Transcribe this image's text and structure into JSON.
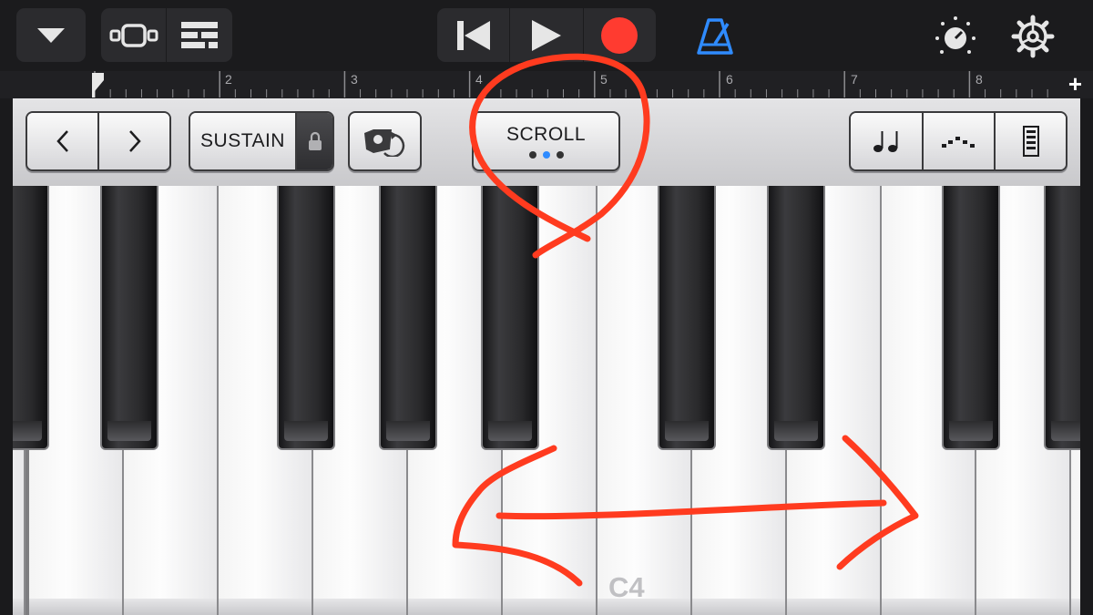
{
  "toolbar": {
    "left_icons": [
      "chevron-down-icon",
      "tracks-view-icon",
      "mixer-icon"
    ],
    "transport_icons": [
      "skip-back-icon",
      "play-icon",
      "record-icon"
    ],
    "right_icons": [
      "metronome-icon",
      "master-knob-icon",
      "gear-icon"
    ],
    "colors": {
      "record": "#ff3b30",
      "metronome": "#2f8bff"
    }
  },
  "ruler": {
    "bars": [
      "2",
      "3",
      "4",
      "5",
      "6",
      "7",
      "8"
    ],
    "add_label": "+"
  },
  "controls": {
    "octave_down_icon": "chevron-left-icon",
    "octave_up_icon": "chevron-right-icon",
    "sustain_label": "SUSTAIN",
    "sustain_lock_icon": "lock-icon",
    "arpeggiator_icon": "arpeggiator-icon",
    "scroll_label": "SCROLL",
    "scroll_mode_index": 1,
    "scroll_mode_count": 3,
    "right_icons": [
      "notes-icon",
      "glissando-icon",
      "velocity-icon"
    ]
  },
  "keyboard": {
    "c4_label": "C4"
  },
  "annotation_color": "#ff3b1f"
}
